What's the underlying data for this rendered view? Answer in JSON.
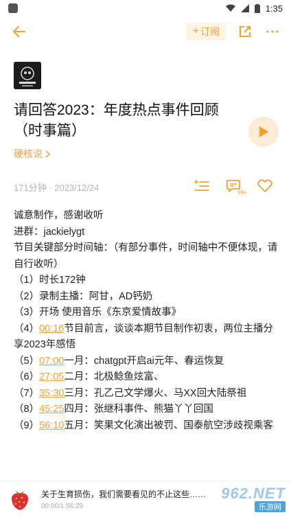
{
  "status": {
    "time": "1:35"
  },
  "header": {
    "subscribe_label": "订阅"
  },
  "episode": {
    "title": "请回答2023：年度热点事件回顾（时事篇）",
    "author": "硬核说",
    "meta": "171分钟 · 2023/12/24",
    "comment_badge": "99+"
  },
  "content": {
    "lines": [
      "诚意制作，感谢收听",
      "进群：jackielygt",
      "节目关键部分时间轴：（有部分事件，时间轴中不便体现，请自行收听）",
      "（1）时长172钟",
      "（2）录制主播：阿甘，AD钙奶",
      "（3）开场  使用音乐《东京爱情故事》"
    ],
    "timeline": [
      {
        "prefix": "（4）",
        "ts": "00:16",
        "text": "节目前言，谈谈本期节目制作初衷，两位主播分享2023年感悟"
      },
      {
        "prefix": "（5）",
        "ts": "07:00",
        "text": "一月：chatgpt开启ai元年、春运恢复"
      },
      {
        "prefix": "（6）",
        "ts": "27:05",
        "text": "二月：北极鲶鱼炫富、"
      },
      {
        "prefix": "（7）",
        "ts": "35:30",
        "text": "三月：孔乙己文学爆火、马XX回大陆祭祖"
      },
      {
        "prefix": "（8）",
        "ts": "45:25",
        "text": "四月：张继科事件、熊猫丫丫回国"
      },
      {
        "prefix": "（9）",
        "ts": "56:10",
        "text": "五月：笑果文化演出被罚、国泰航空涉歧视乘客"
      }
    ]
  },
  "player": {
    "title": "关于生育损伤，我们需要看见的不止这些……",
    "time": "00:00/1:56:29"
  },
  "watermark": {
    "number": "962.NET",
    "sub": "乐游网"
  },
  "colors": {
    "accent": "#f0a030",
    "accent_bg": "#fdebd6"
  }
}
